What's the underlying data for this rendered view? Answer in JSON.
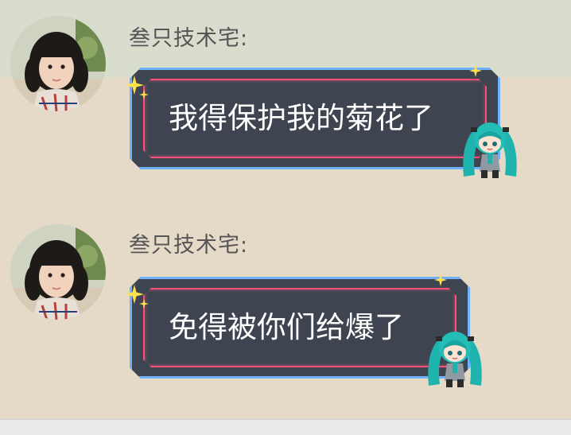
{
  "chat": {
    "messages": [
      {
        "sender": "叁只技术宅:",
        "text": "我得保护我的菊花了"
      },
      {
        "sender": "叁只技术宅:",
        "text": "免得被你们给爆了"
      }
    ]
  },
  "colors": {
    "top_band": "#d8ddcd",
    "background": "#e5dac7",
    "bubble_fill": "#3e4550",
    "bubble_outer_border": "#6fb0ff",
    "bubble_inner_border": "#ff4f79",
    "sparkle": "#ffe14d",
    "sender_text": "#565656"
  },
  "icons": [
    "avatar-photo",
    "sparkle-icon",
    "miku-sticker-icon"
  ]
}
